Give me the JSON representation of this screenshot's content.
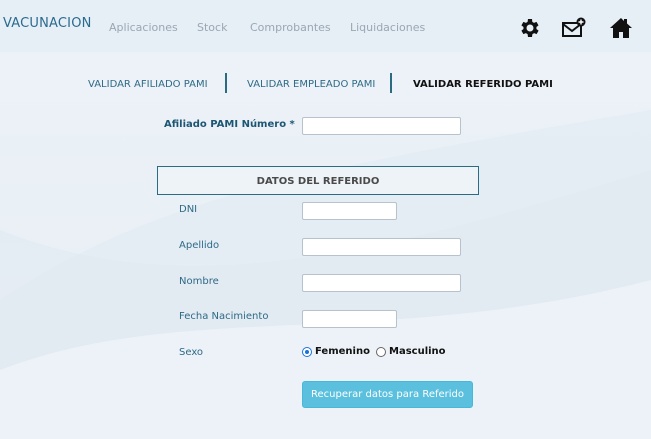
{
  "header": {
    "brand": "VACUNACION",
    "menu": [
      "Aplicaciones",
      "Stock",
      "Comprobantes",
      "Liquidaciones"
    ],
    "icons": [
      "gear-icon",
      "mail-add-icon",
      "home-icon"
    ]
  },
  "tabs": [
    {
      "label": "VALIDAR AFILIADO PAMI",
      "active": false
    },
    {
      "label": "VALIDAR EMPLEADO PAMI",
      "active": false
    },
    {
      "label": "VALIDAR REFERIDO PAMI",
      "active": true
    }
  ],
  "form": {
    "afiliado_label": "Afiliado PAMI Número *",
    "afiliado_value": "",
    "section_title": "DATOS DEL REFERIDO",
    "dni_label": "DNI",
    "dni_value": "",
    "apellido_label": "Apellido",
    "apellido_value": "",
    "nombre_label": "Nombre",
    "nombre_value": "",
    "fecha_label": "Fecha Nacimiento",
    "fecha_value": "",
    "sexo_label": "Sexo",
    "sexo_options": [
      "Femenino",
      "Masculino"
    ],
    "sexo_selected": "Femenino",
    "submit_label": "Recuperar datos para Referido"
  },
  "colors": {
    "accent": "#5bc0de",
    "brand": "#2a6b8e",
    "tab_separator": "#2a6b7f"
  }
}
